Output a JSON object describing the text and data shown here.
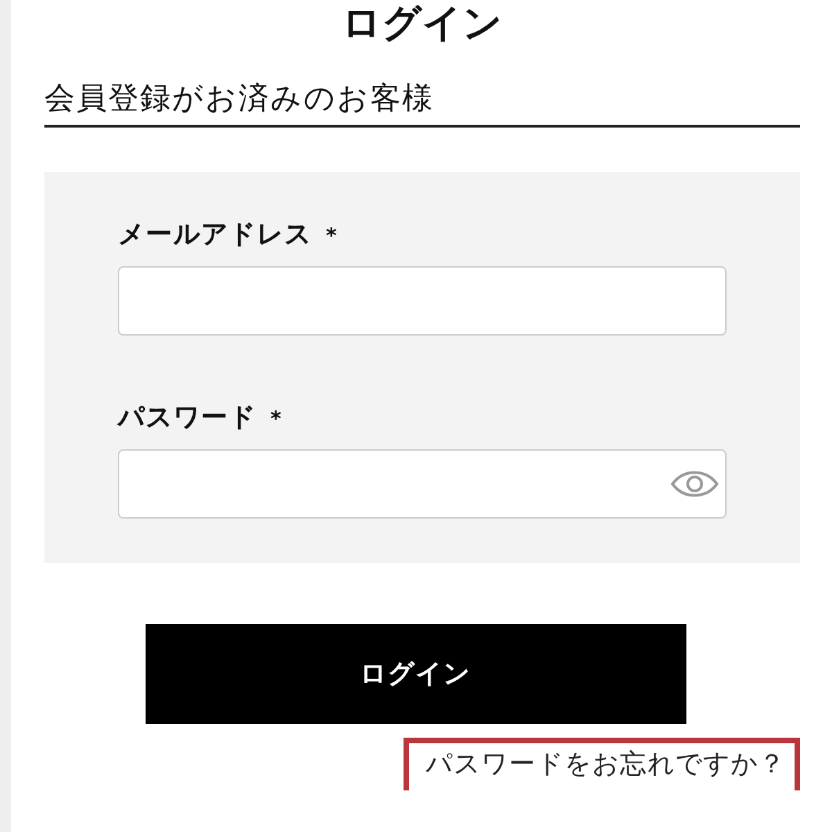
{
  "title": "ログイン",
  "section_heading": "会員登録がお済みのお客様",
  "fields": [
    {
      "kind": "email",
      "label": "メールアドレス",
      "required_mark": "*"
    },
    {
      "kind": "password",
      "label": "パスワード",
      "required_mark": "*"
    }
  ],
  "submit_button": "ログイン",
  "forgot_link": {
    "text": "パスワードをお忘れですか？",
    "highlighted": true
  }
}
